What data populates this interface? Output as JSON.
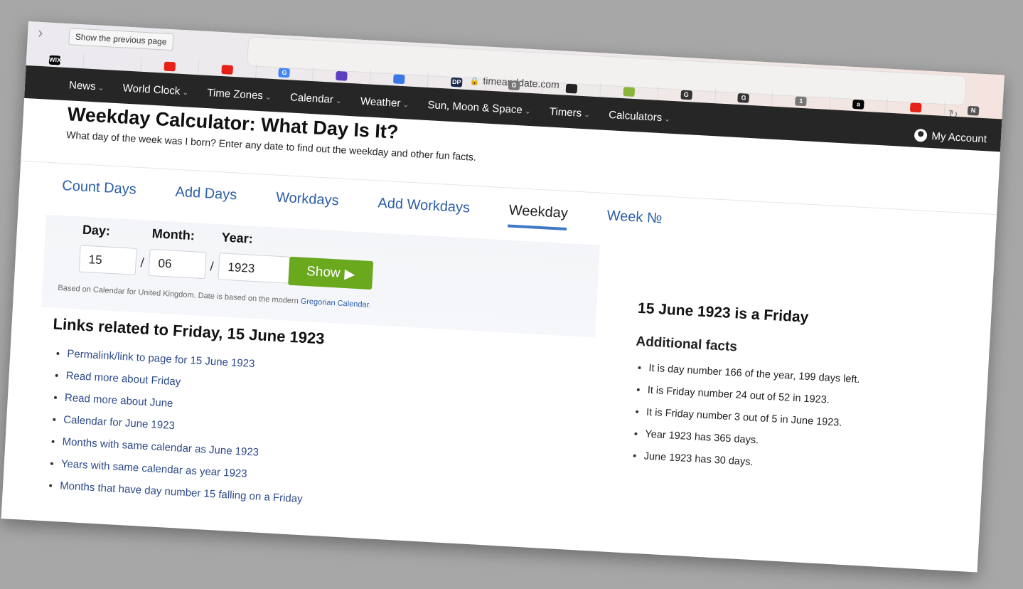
{
  "browser": {
    "tooltip": "Show the previous page",
    "url": "timeanddate.com",
    "bookmarks": [
      {
        "icon": "wix-favicon",
        "label": "WIX",
        "color": "#000000"
      },
      {
        "icon": "blank",
        "label": "",
        "color": ""
      },
      {
        "icon": "youtube-favicon",
        "label": "",
        "color": "#e62117"
      },
      {
        "icon": "youtube-favicon",
        "label": "",
        "color": "#e62117"
      },
      {
        "icon": "google-favicon",
        "label": "G",
        "color": "#4285f4"
      },
      {
        "icon": "forms-favicon",
        "label": "",
        "color": "#5a3fc0"
      },
      {
        "icon": "docs-favicon",
        "label": "",
        "color": "#3b78e7"
      },
      {
        "icon": "dp-favicon",
        "label": "DP",
        "color": "#1a2a4a"
      },
      {
        "icon": "g-favicon",
        "label": "G",
        "color": "#777777"
      },
      {
        "icon": "openai-favicon",
        "label": "",
        "color": "#222222"
      },
      {
        "icon": "arrow-favicon",
        "label": "",
        "color": "#8ab43a"
      },
      {
        "icon": "g-serif-favicon",
        "label": "G",
        "color": "#333333"
      },
      {
        "icon": "g-serif-favicon",
        "label": "G",
        "color": "#333333"
      },
      {
        "icon": "one-favicon",
        "label": "1",
        "color": "#777777"
      },
      {
        "icon": "amazon-favicon",
        "label": "a",
        "color": "#000000"
      },
      {
        "icon": "youtube-favicon",
        "label": "",
        "color": "#e62117"
      },
      {
        "icon": "notion-favicon",
        "label": "N",
        "color": "#555555"
      }
    ]
  },
  "nav": {
    "items": [
      "News",
      "World Clock",
      "Time Zones",
      "Calendar",
      "Weather",
      "Sun, Moon & Space",
      "Timers",
      "Calculators"
    ],
    "account": "My Account"
  },
  "page": {
    "title": "Weekday Calculator: What Day Is It?",
    "subtitle": "What day of the week was I born? Enter any date to find out the weekday and other fun facts."
  },
  "tabs": [
    {
      "label": "Count Days",
      "active": false
    },
    {
      "label": "Add Days",
      "active": false
    },
    {
      "label": "Workdays",
      "active": false
    },
    {
      "label": "Add Workdays",
      "active": false
    },
    {
      "label": "Weekday",
      "active": true
    },
    {
      "label": "Week №",
      "active": false
    }
  ],
  "form": {
    "day_label": "Day:",
    "month_label": "Month:",
    "year_label": "Year:",
    "day": "15",
    "month": "06",
    "year": "1923",
    "separator": "/",
    "show_label": "Show",
    "note_prefix": "Based on Calendar for United Kingdom. Date is based on the modern",
    "note_link": "Gregorian Calendar",
    "note_suffix": "."
  },
  "result": {
    "title": "15 June 1923 is a Friday",
    "facts_heading": "Additional facts",
    "facts": [
      "It is day number 166 of the year, 199 days left.",
      "It is Friday number 24 out of 52 in 1923.",
      "It is Friday number 3 out of 5 in June 1923.",
      "Year 1923 has 365 days.",
      "June 1923 has 30 days."
    ]
  },
  "links": {
    "heading": "Links related to Friday, 15 June 1923",
    "items": [
      "Permalink/link to page for 15 June 1923",
      "Read more about Friday",
      "Read more about June",
      "Calendar for June 1923",
      "Months with same calendar as June 1923",
      "Years with same calendar as year 1923",
      "Months that have day number 15 falling on a Friday"
    ]
  }
}
